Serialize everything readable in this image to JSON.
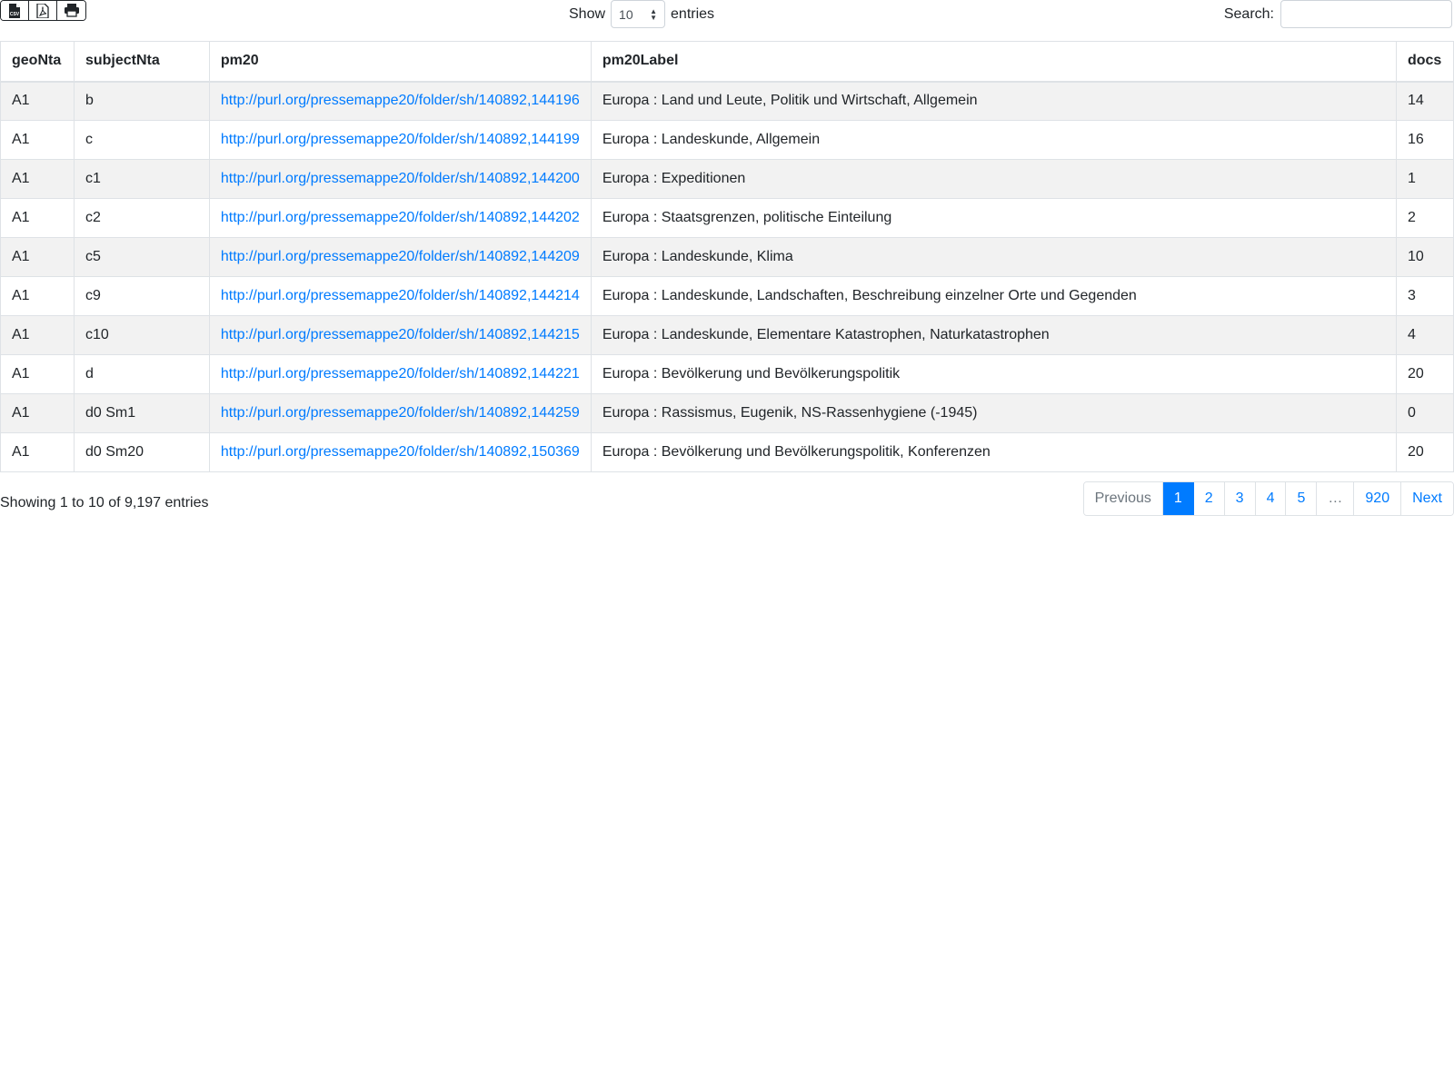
{
  "toolbar": {
    "buttons": [
      {
        "name": "csv-button",
        "icon": "csv-file-icon",
        "label": "CSV"
      },
      {
        "name": "pdf-button",
        "icon": "pdf-file-icon"
      },
      {
        "name": "print-button",
        "icon": "print-icon"
      }
    ]
  },
  "length": {
    "show_label": "Show",
    "value": "10",
    "entries_label": "entries"
  },
  "search": {
    "label": "Search:",
    "value": ""
  },
  "table": {
    "columns": [
      "geoNta",
      "subjectNta",
      "pm20",
      "pm20Label",
      "docs"
    ],
    "rows": [
      [
        "A1",
        "b",
        "http://purl.org/pressemappe20/folder/sh/140892,144196",
        "Europa : Land und Leute, Politik und Wirtschaft, Allgemein",
        "14"
      ],
      [
        "A1",
        "c",
        "http://purl.org/pressemappe20/folder/sh/140892,144199",
        "Europa : Landeskunde, Allgemein",
        "16"
      ],
      [
        "A1",
        "c1",
        "http://purl.org/pressemappe20/folder/sh/140892,144200",
        "Europa : Expeditionen",
        "1"
      ],
      [
        "A1",
        "c2",
        "http://purl.org/pressemappe20/folder/sh/140892,144202",
        "Europa : Staatsgrenzen, politische Einteilung",
        "2"
      ],
      [
        "A1",
        "c5",
        "http://purl.org/pressemappe20/folder/sh/140892,144209",
        "Europa : Landeskunde, Klima",
        "10"
      ],
      [
        "A1",
        "c9",
        "http://purl.org/pressemappe20/folder/sh/140892,144214",
        "Europa : Landeskunde, Landschaften, Beschreibung einzelner Orte und Gegenden",
        "3"
      ],
      [
        "A1",
        "c10",
        "http://purl.org/pressemappe20/folder/sh/140892,144215",
        "Europa : Landeskunde, Elementare Katastrophen, Naturkatastrophen",
        "4"
      ],
      [
        "A1",
        "d",
        "http://purl.org/pressemappe20/folder/sh/140892,144221",
        "Europa : Bevölkerung und Bevölkerungspolitik",
        "20"
      ],
      [
        "A1",
        "d0 Sm1",
        "http://purl.org/pressemappe20/folder/sh/140892,144259",
        "Europa : Rassismus, Eugenik, NS-Rassenhygiene (-1945)",
        "0"
      ],
      [
        "A1",
        "d0 Sm20",
        "http://purl.org/pressemappe20/folder/sh/140892,150369",
        "Europa : Bevölkerung und Bevölkerungspolitik, Konferenzen",
        "20"
      ]
    ]
  },
  "info": {
    "text": "Showing 1 to 10 of 9,197 entries"
  },
  "pagination": {
    "previous": "Previous",
    "pages": [
      "1",
      "2",
      "3",
      "4",
      "5"
    ],
    "ellipsis": "…",
    "last": "920",
    "next": "Next",
    "current": "1"
  },
  "colors": {
    "link": "#007bff",
    "active_page_bg": "#007bff",
    "stripe": "#f2f2f2",
    "border": "#dee2e6"
  }
}
